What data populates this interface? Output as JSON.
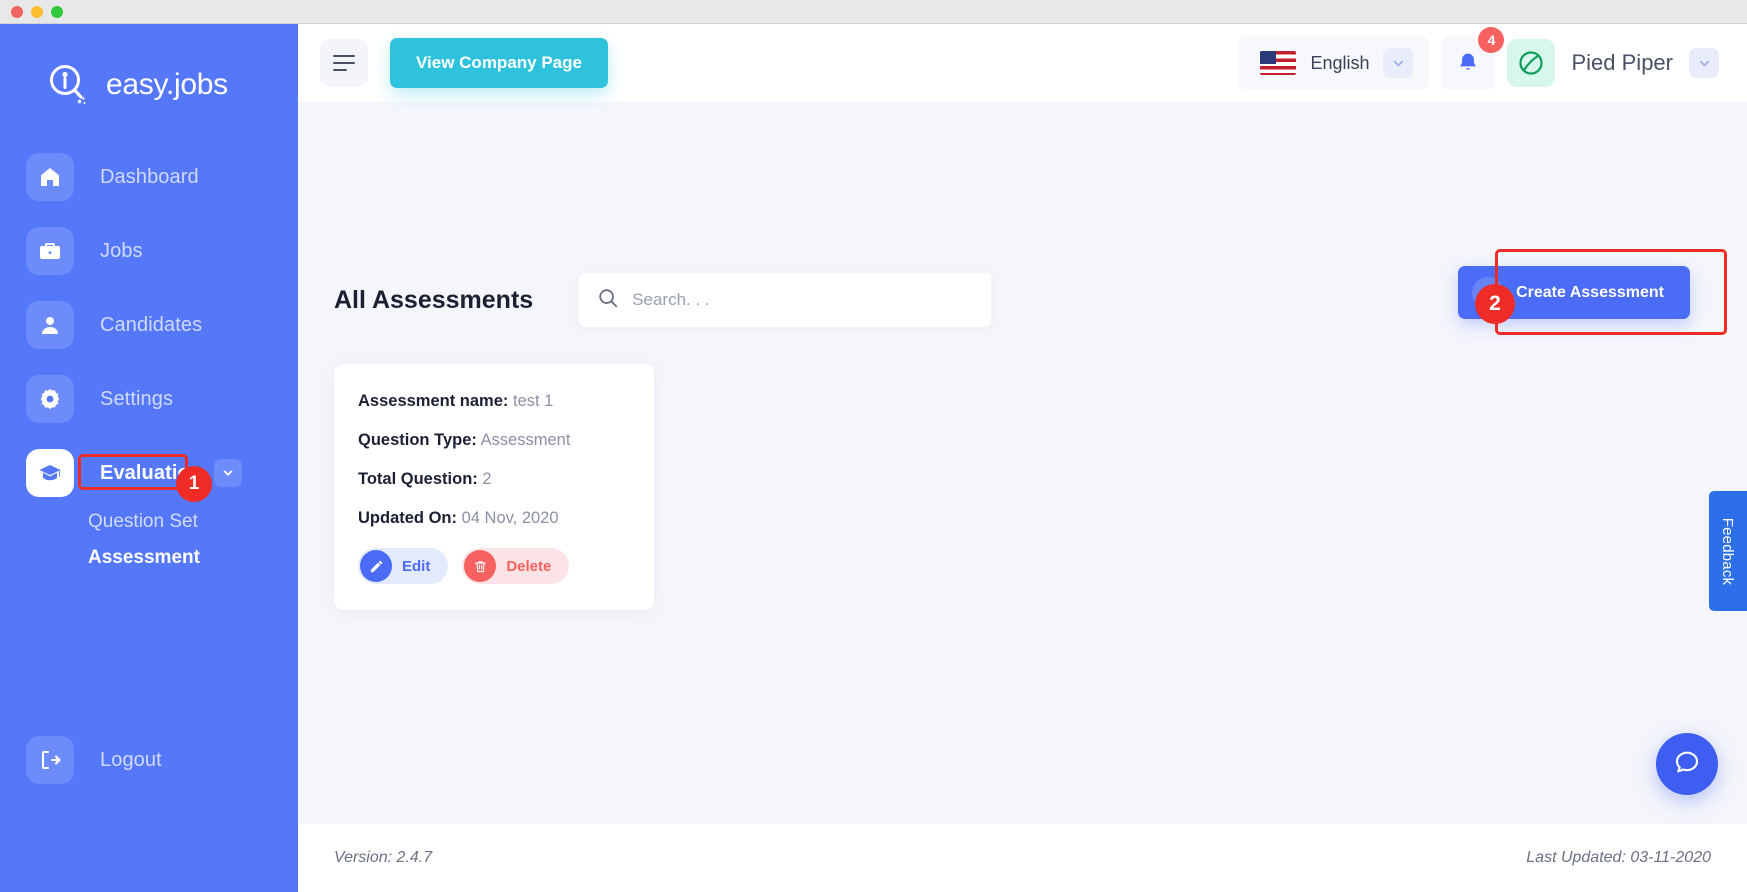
{
  "window": {
    "traffic_lights": [
      "close",
      "minimize",
      "maximize"
    ]
  },
  "sidebar": {
    "brand": "easy.jobs",
    "brand_icon": "magnifier-person-logo-icon",
    "items": [
      {
        "label": "Dashboard",
        "icon": "home-icon",
        "active": false
      },
      {
        "label": "Jobs",
        "icon": "briefcase-icon",
        "active": false
      },
      {
        "label": "Candidates",
        "icon": "user-icon",
        "active": false
      },
      {
        "label": "Settings",
        "icon": "gear-icon",
        "active": false
      },
      {
        "label": "Evaluation",
        "icon": "graduation-cap-icon",
        "active": true
      }
    ],
    "sub_items": [
      {
        "label": "Question Set",
        "active": false
      },
      {
        "label": "Assessment",
        "active": true
      }
    ],
    "logout": {
      "label": "Logout",
      "icon": "logout-icon"
    }
  },
  "header": {
    "menu_icon": "hamburger-icon",
    "company_page_button": "View Company Page",
    "language": {
      "value": "English",
      "flag": "us-flag-icon",
      "caret": "chevron-down-icon"
    },
    "notifications": {
      "icon": "bell-icon",
      "count": "4"
    },
    "user": {
      "name": "Pied Piper",
      "avatar_icon": "pied-piper-logo-icon",
      "caret": "chevron-down-icon"
    }
  },
  "main": {
    "page_title": "All Assessments",
    "search": {
      "placeholder": "Search. . .",
      "value": "",
      "icon": "search-icon"
    },
    "create_button": {
      "label": "Create Assessment",
      "icon": "plus-icon"
    },
    "cards": [
      {
        "fields": [
          {
            "key": "Assessment name:",
            "value": "test 1"
          },
          {
            "key": "Question Type:",
            "value": "Assessment"
          },
          {
            "key": "Total Question:",
            "value": "2"
          },
          {
            "key": "Updated On:",
            "value": "04 Nov, 2020"
          }
        ],
        "actions": [
          {
            "label": "Edit",
            "icon": "pencil-icon"
          },
          {
            "label": "Delete",
            "icon": "trash-icon"
          }
        ]
      }
    ],
    "feedback_tab": "Feedback",
    "chat_button_icon": "chat-bubble-icon"
  },
  "footer": {
    "version": "Version: 2.4.7",
    "last_updated": "Last Updated: 03-11-2020"
  },
  "annotations": [
    {
      "id": "1",
      "target": "sidebar-assessment"
    },
    {
      "id": "2",
      "target": "create-assessment-button"
    }
  ],
  "colors": {
    "sidebar_blue": "#5578fa",
    "primary_blue": "#4a6cf7",
    "cyan": "#2fc2dd",
    "danger_red": "#f7615f",
    "annotation_red": "#ee2b26",
    "page_bg": "#f5f6fb"
  }
}
